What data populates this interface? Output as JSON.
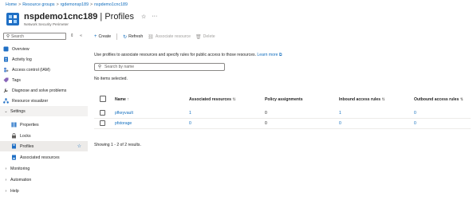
{
  "breadcrumb": {
    "items": [
      "Home",
      "Resource groups",
      "rgdemonsp189",
      "nspdemo1cnc189"
    ],
    "separator": ">"
  },
  "header": {
    "resource_name": "nspdemo1cnc189",
    "divider": " | ",
    "blade_title": "Profiles",
    "resource_type": "Network Security Perimeter",
    "favorite_icon": "star-outline-icon",
    "more_icon": "ellipsis-icon"
  },
  "sidebar": {
    "search_placeholder": "Search",
    "nav": [
      {
        "label": "Overview",
        "icon": "overview-icon"
      },
      {
        "label": "Activity log",
        "icon": "activity-log-icon"
      },
      {
        "label": "Access control (IAM)",
        "icon": "iam-icon"
      },
      {
        "label": "Tags",
        "icon": "tag-icon"
      },
      {
        "label": "Diagnose and solve problems",
        "icon": "wrench-icon"
      },
      {
        "label": "Resource visualizer",
        "icon": "visualizer-icon"
      },
      {
        "label": "Settings",
        "icon": "chevron-down-icon"
      },
      {
        "label": "Properties",
        "icon": "properties-icon"
      },
      {
        "label": "Locks",
        "icon": "lock-icon"
      },
      {
        "label": "Profiles",
        "icon": "profiles-icon"
      },
      {
        "label": "Associated resources",
        "icon": "associated-resources-icon"
      },
      {
        "label": "Monitoring",
        "icon": "chevron-right-icon"
      },
      {
        "label": "Automation",
        "icon": "chevron-right-icon"
      },
      {
        "label": "Help",
        "icon": "chevron-right-icon"
      }
    ]
  },
  "toolbar": {
    "create": "Create",
    "refresh": "Refresh",
    "associate": "Associate resource",
    "delete": "Delete"
  },
  "main": {
    "description": "Use profiles to associate resources and specify rules for public access to those resources.",
    "learn_more": "Learn more",
    "search_placeholder": "Search by name",
    "selection_status": "No items selected.",
    "columns": [
      "Name",
      "Associated resources",
      "Policy assignments",
      "Inbound access rules",
      "Outbound access rules"
    ],
    "rows": [
      {
        "name": "pfkeyvault",
        "associated": "1",
        "policy": "0",
        "inbound": "1",
        "outbound": "0"
      },
      {
        "name": "pfstorage",
        "associated": "0",
        "policy": "0",
        "inbound": "0",
        "outbound": "0"
      }
    ],
    "showing": "Showing 1 - 2 of 2 results."
  },
  "colors": {
    "accent": "#0f6cbd",
    "selected_bg": "#edebe9",
    "text": "#242424",
    "muted": "#605e5c"
  }
}
